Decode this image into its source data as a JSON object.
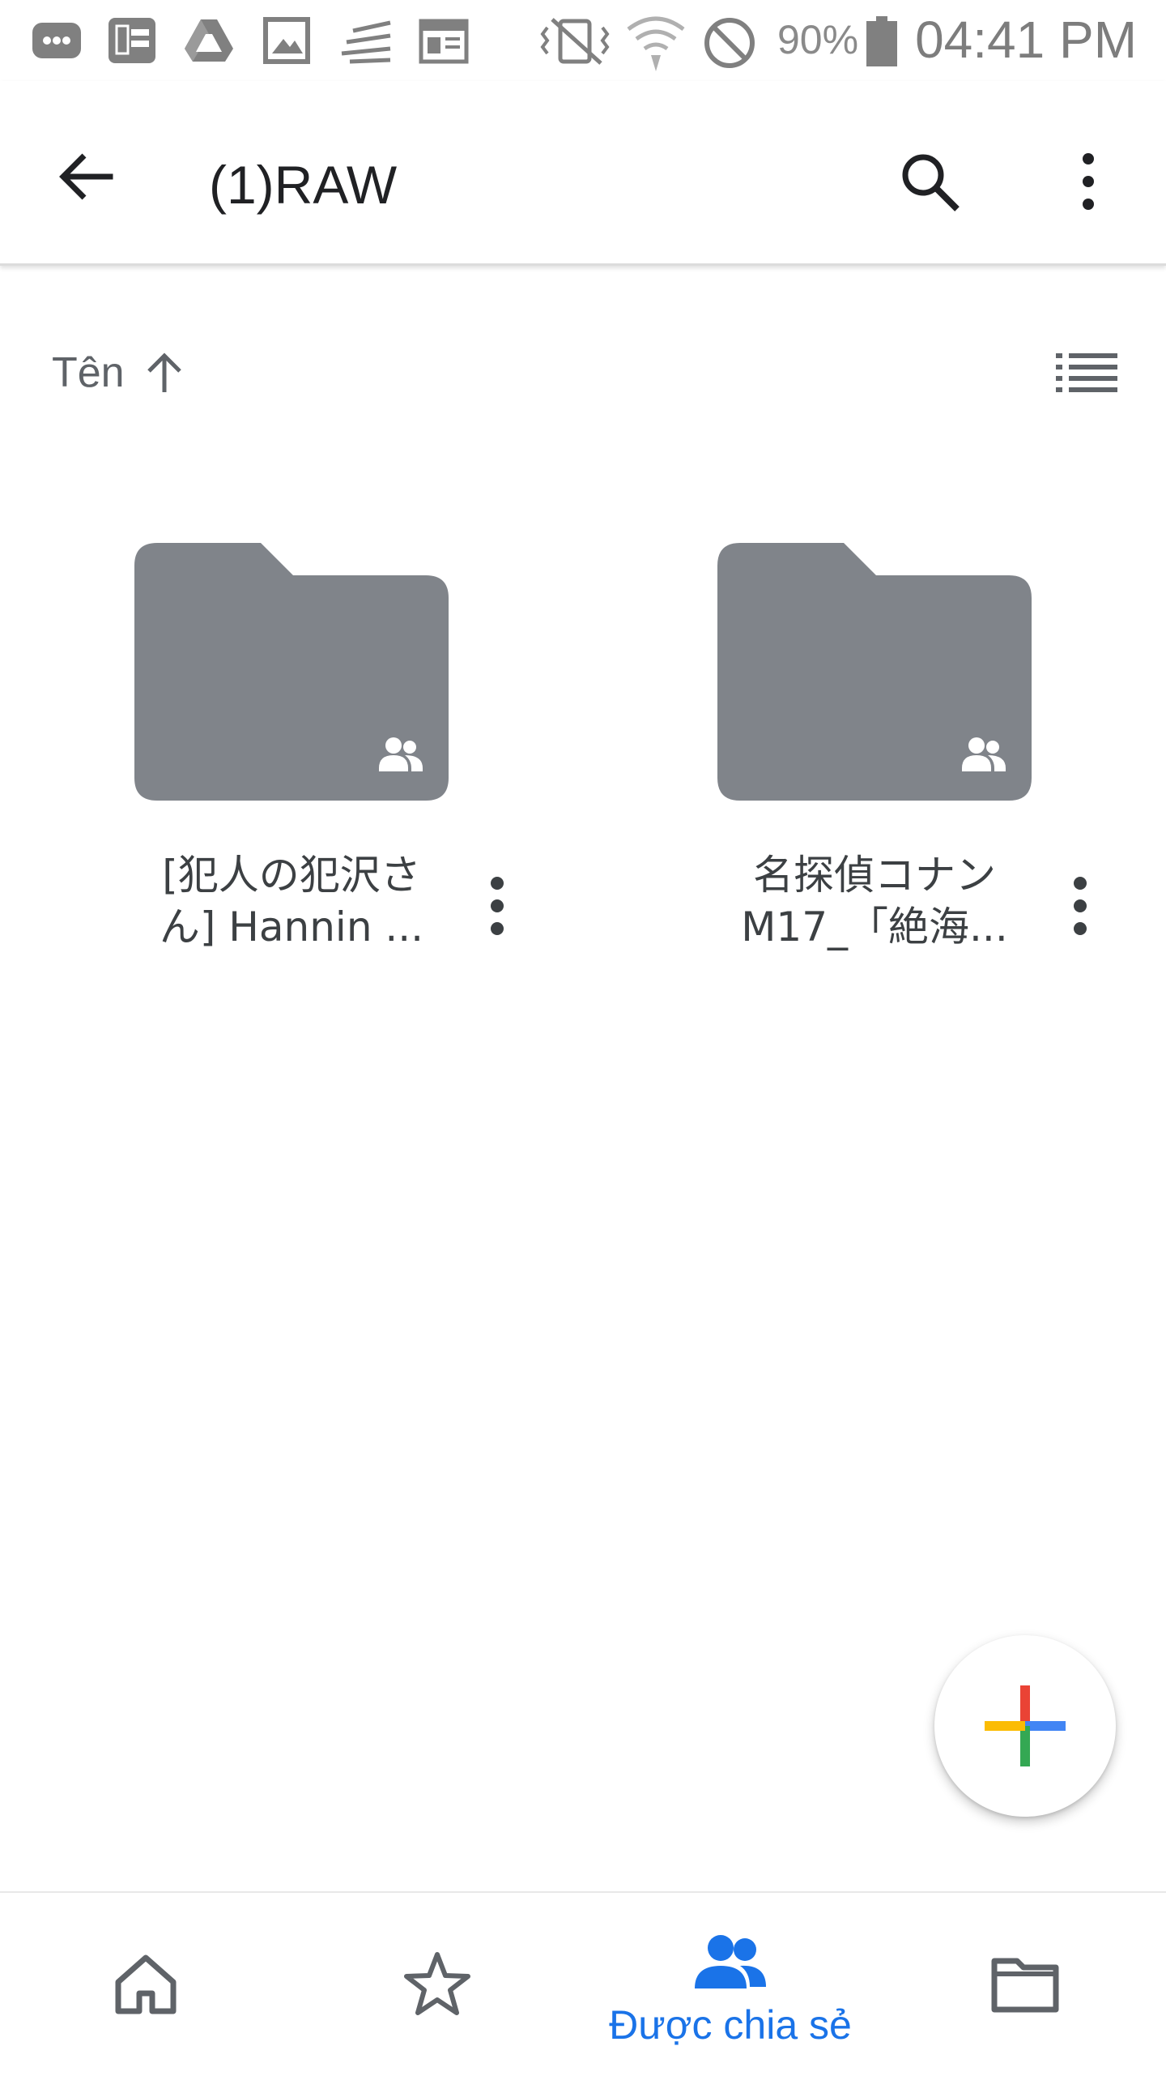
{
  "status_bar": {
    "battery_percent": "90%",
    "time": "04:41 PM",
    "icons": [
      "messages-icon",
      "bao-hay-icon",
      "drive-icon",
      "gallery-icon",
      "signal-lines-icon",
      "news-icon",
      "vibrate-icon",
      "wifi-icon",
      "do-not-disturb-icon",
      "battery-icon"
    ]
  },
  "app_bar": {
    "title": "(1)RAW",
    "back_icon": "arrow-back-icon",
    "search_icon": "search-icon",
    "more_icon": "more-vert-icon"
  },
  "sort": {
    "label": "Tên",
    "direction_icon": "arrow-up-icon",
    "view_toggle_icon": "list-view-icon"
  },
  "folders": [
    {
      "name_line1": "[犯人の犯沢さ",
      "name_line2": "ん] Hannin ...",
      "shared": true
    },
    {
      "name_line1": "名探偵コナン",
      "name_line2": "M17_「絶海...",
      "shared": true
    }
  ],
  "fab": {
    "icon": "plus-icon"
  },
  "bottom_nav": {
    "items": [
      {
        "icon": "home-icon",
        "label": "",
        "active": false
      },
      {
        "icon": "star-icon",
        "label": "",
        "active": false
      },
      {
        "icon": "people-icon",
        "label": "Được chia sẻ",
        "active": true
      },
      {
        "icon": "folder-icon",
        "label": "",
        "active": false
      }
    ]
  },
  "colors": {
    "folder": "#80848a",
    "active_nav": "#1a73e8",
    "icon": "#5f6368",
    "text": "#202124",
    "fab_red": "#ea4335",
    "fab_blue": "#4285f4",
    "fab_green": "#34a853",
    "fab_yellow": "#fbbc04"
  }
}
